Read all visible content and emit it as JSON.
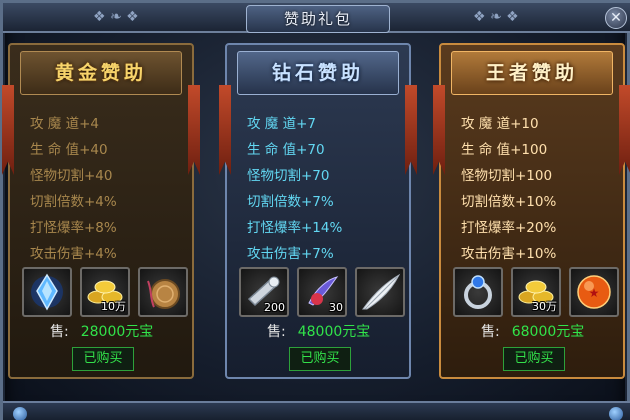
{
  "window": {
    "title": "赞助礼包",
    "close_icon": "close-icon"
  },
  "panels": [
    {
      "name": "黄金赞助",
      "stats": [
        "攻 魔 道+4",
        "生 命 值+40",
        "怪物切割+40",
        "切割倍数+4%",
        "打怪爆率+8%",
        "攻击伤害+4%"
      ],
      "items": [
        {
          "icon": "blue-crystal-icon",
          "qty": ""
        },
        {
          "icon": "gold-ingots-icon",
          "qty": "10万"
        },
        {
          "icon": "leather-pouch-icon",
          "qty": ""
        }
      ],
      "price_label": "售:",
      "price": "28000元宝",
      "status": "已购买"
    },
    {
      "name": "钻石赞助",
      "stats": [
        "攻 魔 道+7",
        "生 命 值+70",
        "怪物切割+70",
        "切割倍数+7%",
        "打怪爆率+14%",
        "攻击伤害+7%"
      ],
      "items": [
        {
          "icon": "horn-icon",
          "qty": "200"
        },
        {
          "icon": "feather-orb-icon",
          "qty": "30"
        },
        {
          "icon": "white-feather-icon",
          "qty": ""
        }
      ],
      "price_label": "售:",
      "price": "48000元宝",
      "status": "已购买"
    },
    {
      "name": "王者赞助",
      "stats": [
        "攻 魔 道+10",
        "生 命 值+100",
        "怪物切割+100",
        "切割倍数+10%",
        "打怪爆率+20%",
        "攻击伤害+10%"
      ],
      "items": [
        {
          "icon": "sapphire-ring-icon",
          "qty": ""
        },
        {
          "icon": "gold-ingots-icon",
          "qty": "30万"
        },
        {
          "icon": "dragon-ball-icon",
          "qty": ""
        }
      ],
      "price_label": "售:",
      "price": "68000元宝",
      "status": "已购买"
    }
  ]
}
